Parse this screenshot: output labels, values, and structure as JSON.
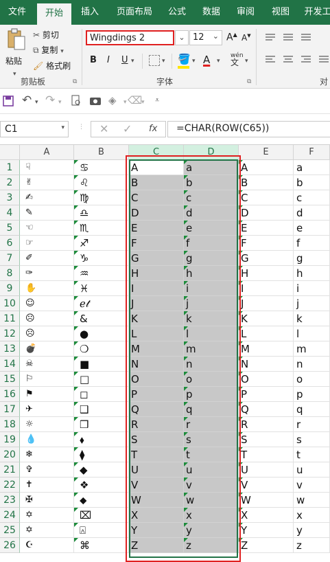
{
  "ribbon_tabs": [
    "文件",
    "开始",
    "插入",
    "页面布局",
    "公式",
    "数据",
    "审阅",
    "视图",
    "开发工"
  ],
  "clipboard": {
    "paste": "粘贴",
    "cut": "剪切",
    "copy": "复制",
    "format_painter": "格式刷",
    "group": "剪贴板"
  },
  "font": {
    "name": "Wingdings 2",
    "size": "12",
    "group": "字体",
    "bold": "B",
    "italic": "I",
    "underline": "U",
    "grow": "A",
    "shrink": "A",
    "phonetic": "wén",
    "accent_red": "#e02020",
    "accent_yellow": "#ffe600",
    "highlight_box": "#e02020"
  },
  "alignment": {
    "group": "对齐"
  },
  "formula_bar": {
    "name_box": "C1",
    "fx": "fx",
    "formula": "=CHAR(ROW(C65))"
  },
  "columns": [
    "A",
    "B",
    "C",
    "D",
    "E",
    "F"
  ],
  "rows": [
    "1",
    "2",
    "3",
    "4",
    "5",
    "6",
    "7",
    "8",
    "9",
    "10",
    "11",
    "12",
    "13",
    "14",
    "15",
    "16",
    "17",
    "18",
    "19",
    "20",
    "21",
    "22",
    "23",
    "24",
    "25",
    "26"
  ],
  "col_a": [
    "☟",
    "✌",
    "✍",
    "✎",
    "☜",
    "☞",
    "✐",
    "✑",
    "✋",
    "☺",
    "☹",
    "☹",
    "💣",
    "☠",
    "⚐",
    "⚑",
    "✈",
    "☼",
    "💧",
    "❄",
    "✞",
    "✝",
    "✠",
    "✡",
    "✡",
    "☪"
  ],
  "col_b": [
    "♋",
    "♌",
    "♍",
    "♎",
    "♏",
    "♐",
    "♑",
    "♒",
    "♓",
    "ℯ𝓉",
    "&",
    "●",
    "❍",
    "■",
    "□",
    "◻",
    "❑",
    "❒",
    "⬧",
    "⧫",
    "◆",
    "❖",
    "⬥",
    "⌧",
    "⍓",
    "⌘"
  ],
  "col_c": [
    "A",
    "B",
    "C",
    "D",
    "E",
    "F",
    "G",
    "H",
    "I",
    "J",
    "K",
    "L",
    "M",
    "N",
    "O",
    "P",
    "Q",
    "R",
    "S",
    "T",
    "U",
    "V",
    "W",
    "X",
    "Y",
    "Z"
  ],
  "col_d": [
    "a",
    "b",
    "c",
    "d",
    "e",
    "f",
    "g",
    "h",
    "i",
    "j",
    "k",
    "l",
    "m",
    "n",
    "o",
    "p",
    "q",
    "r",
    "s",
    "t",
    "u",
    "v",
    "w",
    "x",
    "y",
    "z"
  ],
  "col_e": [
    "A",
    "B",
    "C",
    "D",
    "E",
    "F",
    "G",
    "H",
    "I",
    "J",
    "K",
    "L",
    "M",
    "N",
    "O",
    "P",
    "Q",
    "R",
    "S",
    "T",
    "U",
    "V",
    "W",
    "X",
    "Y",
    "Z"
  ],
  "col_f": [
    "a",
    "b",
    "c",
    "d",
    "e",
    "f",
    "g",
    "h",
    "i",
    "j",
    "k",
    "l",
    "m",
    "n",
    "o",
    "p",
    "q",
    "r",
    "s",
    "t",
    "u",
    "v",
    "w",
    "x",
    "y",
    "z"
  ]
}
